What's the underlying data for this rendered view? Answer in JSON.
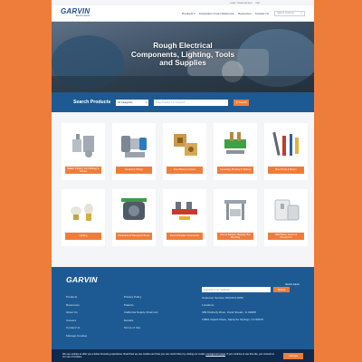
{
  "utility": {
    "login": "Login / Create Account",
    "cart": "Cart"
  },
  "header": {
    "logo_word": "GARVIN",
    "logo_sub": "Electric Garvin",
    "nav": [
      "Products ▾",
      "Competitor Cross Reference",
      "Resources",
      "Contact Us"
    ],
    "search_placeholder": "Search products"
  },
  "hero": {
    "title_line1": "Rough Electrical",
    "title_line2": "Components, Lighting, Tools",
    "title_line3": "and Supplies"
  },
  "search": {
    "label": "Search Products",
    "category": "All Categories",
    "placeholder": "Enter Product # or Keyword",
    "button": "Search"
  },
  "products": [
    {
      "label": "Ballast Training, Cord Fittings & Clamps",
      "icon": "connector-icon"
    },
    {
      "label": "Conduit & Fittings",
      "icon": "fitting-icon"
    },
    {
      "label": "Floor Boxes & Covers",
      "icon": "floorbox-icon"
    },
    {
      "label": "Grounding, Bonding & Splicing",
      "icon": "grounding-icon"
    },
    {
      "label": "Hand Tools & Meters",
      "icon": "tools-icon"
    },
    {
      "label": "Lighting",
      "icon": "lighting-icon"
    },
    {
      "label": "Hazardous & Waterproof Boxes",
      "icon": "box-icon"
    },
    {
      "label": "Panel & Breaker Accessories",
      "icon": "panel-icon"
    },
    {
      "label": "Strut & Support, Hanging, Box Mounting",
      "icon": "strut-icon"
    },
    {
      "label": "Wall Plates, Covers & Accessories",
      "icon": "wallplate-icon"
    }
  ],
  "footer": {
    "logo_word": "GARVIN",
    "logo_sub": "Electric Garvin",
    "col1": [
      "Products",
      "Resources",
      "About Us",
      "Careers",
      "Contact Us",
      "Manage Cookies"
    ],
    "col2": [
      "Privacy Policy",
      "Patents",
      "California Supply Chain Act",
      "Recalls",
      "Terms of Use"
    ],
    "newsletter_placeholder": "Subscribe to our newsletter",
    "newsletter_button": "Submit",
    "contact": [
      "Customer Service: 800-624-0168",
      "Locations",
      "489 Kimberly Drive, Carol Stream, IL 60188",
      "13801 Reach Place, Santa Fe Springs, CA 90670"
    ],
    "copyright": "© 2024 Garvin Industries, LLC. All Rights Reserved."
  },
  "cookie": {
    "text": "We use cookies to offer you a better browsing experience. Read how we use cookies and how you can control them by visiting our cookie",
    "link": "management page",
    "text2": ". If you continue to use this site, you consent to our use of cookies.",
    "button": "I Accept"
  },
  "colors": {
    "accent": "#ee7d3c",
    "brand": "#1d5a93",
    "cookie_bg": "#0e2a4d"
  }
}
